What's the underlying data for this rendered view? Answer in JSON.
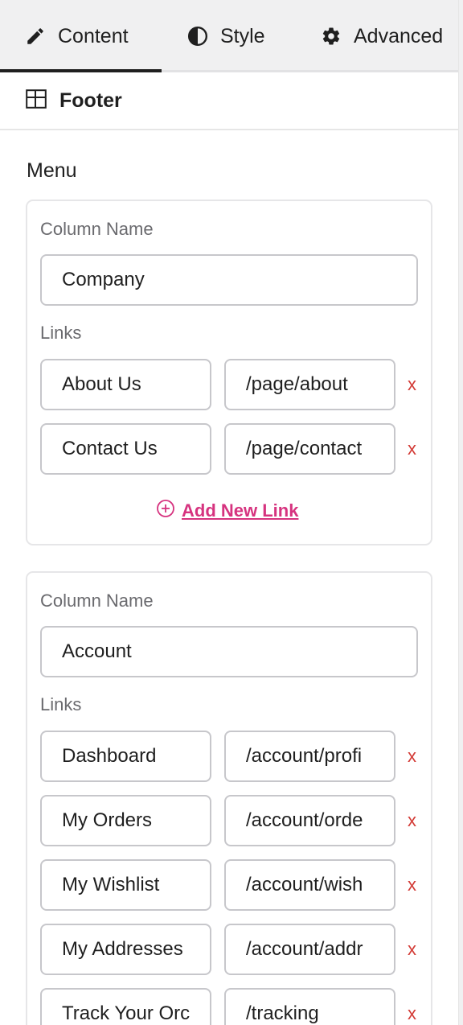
{
  "tabs": [
    {
      "label": "Content",
      "icon": "pencil-icon"
    },
    {
      "label": "Style",
      "icon": "contrast-icon"
    },
    {
      "label": "Advanced",
      "icon": "gear-icon"
    }
  ],
  "section": {
    "title": "Footer",
    "icon": "layout-icon"
  },
  "menu_label": "Menu",
  "columns": [
    {
      "name_label": "Column Name",
      "name_value": "Company",
      "links_label": "Links",
      "links": [
        {
          "label": "About Us",
          "url": "/page/about"
        },
        {
          "label": "Contact Us",
          "url": "/page/contact"
        }
      ],
      "add_link_label": "Add New Link"
    },
    {
      "name_label": "Column Name",
      "name_value": "Account",
      "links_label": "Links",
      "links": [
        {
          "label": "Dashboard",
          "url": "/account/profi"
        },
        {
          "label": "My Orders",
          "url": "/account/orde"
        },
        {
          "label": "My Wishlist",
          "url": "/account/wish"
        },
        {
          "label": "My Addresses",
          "url": "/account/addr"
        },
        {
          "label": "Track Your Orc",
          "url": "/tracking"
        }
      ]
    }
  ],
  "remove_symbol": "x",
  "colors": {
    "accent": "#d6337f",
    "danger": "#d33b36",
    "text": "#1f1f1f",
    "muted": "#6a6a6e"
  }
}
